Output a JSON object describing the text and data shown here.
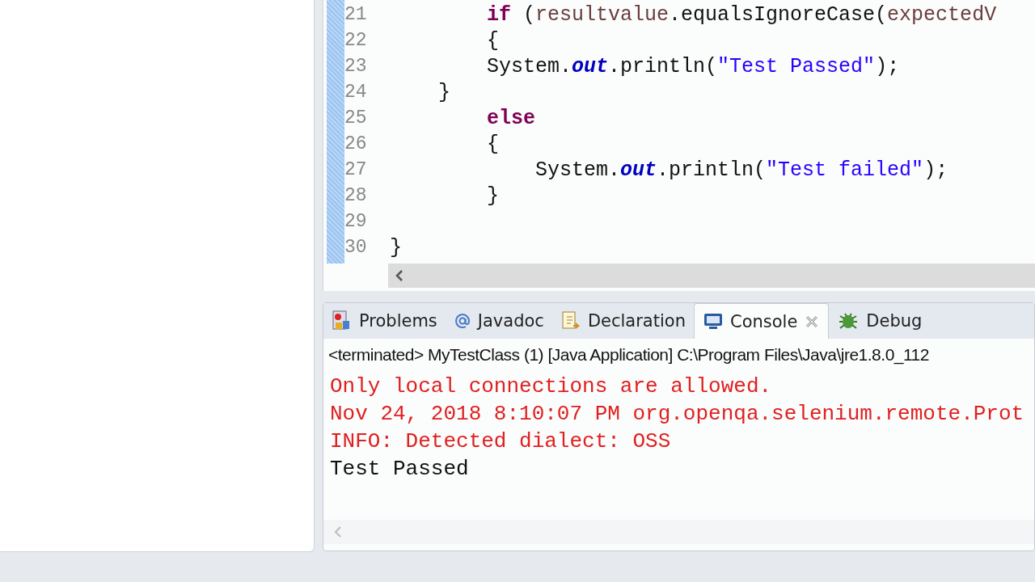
{
  "editor": {
    "lines": [
      {
        "number": "21",
        "tokens": [
          {
            "kind": "keyword",
            "text": "        if"
          },
          {
            "kind": "plain",
            "text": " ("
          },
          {
            "kind": "var",
            "text": "resultvalue"
          },
          {
            "kind": "plain",
            "text": ".equalsIgnoreCase("
          },
          {
            "kind": "var",
            "text": "expectedV"
          }
        ]
      },
      {
        "number": "22",
        "tokens": [
          {
            "kind": "plain",
            "text": "        {"
          }
        ]
      },
      {
        "number": "23",
        "tokens": [
          {
            "kind": "plain",
            "text": "        System."
          },
          {
            "kind": "field",
            "text": "out"
          },
          {
            "kind": "plain",
            "text": ".println("
          },
          {
            "kind": "string",
            "text": "\"Test Passed\""
          },
          {
            "kind": "plain",
            "text": ");"
          }
        ]
      },
      {
        "number": "24",
        "tokens": [
          {
            "kind": "plain",
            "text": "    }"
          }
        ]
      },
      {
        "number": "25",
        "tokens": [
          {
            "kind": "keyword",
            "text": "        else"
          }
        ]
      },
      {
        "number": "26",
        "tokens": [
          {
            "kind": "plain",
            "text": "        {"
          }
        ]
      },
      {
        "number": "27",
        "tokens": [
          {
            "kind": "plain",
            "text": "            System."
          },
          {
            "kind": "field",
            "text": "out"
          },
          {
            "kind": "plain",
            "text": ".println("
          },
          {
            "kind": "string",
            "text": "\"Test failed\""
          },
          {
            "kind": "plain",
            "text": ");"
          }
        ]
      },
      {
        "number": "28",
        "tokens": [
          {
            "kind": "plain",
            "text": "        }"
          }
        ]
      },
      {
        "number": "29"
      },
      {
        "number": "30",
        "tokens": [
          {
            "kind": "plain",
            "text": "}"
          }
        ]
      }
    ]
  },
  "bottom_panel": {
    "tabs": [
      {
        "label": "Problems",
        "selected": false,
        "closable": false
      },
      {
        "label": "Javadoc",
        "selected": false,
        "closable": false
      },
      {
        "label": "Declaration",
        "selected": false,
        "closable": false
      },
      {
        "label": "Console",
        "selected": true,
        "closable": true
      },
      {
        "label": "Debug",
        "selected": false,
        "closable": false
      }
    ],
    "header": "<terminated> MyTestClass (1) [Java Application] C:\\Program Files\\Java\\jre1.8.0_112",
    "output": [
      {
        "text": "Only local connections are allowed.",
        "kind": "stderr"
      },
      {
        "text": "Nov 24, 2018 8:10:07 PM org.openqa.selenium.remote.Prot",
        "kind": "stderr"
      },
      {
        "text": "INFO: Detected dialect: OSS",
        "kind": "stderr"
      },
      {
        "text": "Test Passed",
        "kind": "stdout"
      }
    ]
  }
}
